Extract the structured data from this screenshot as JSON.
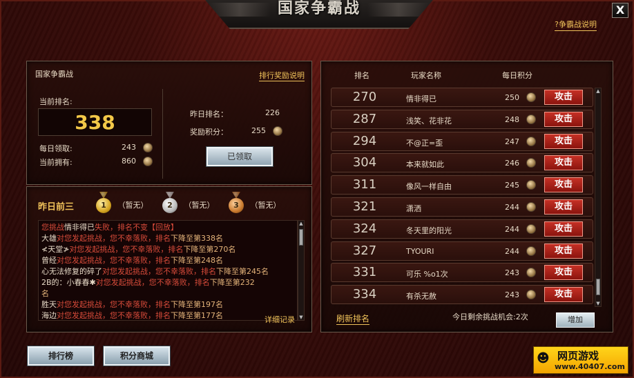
{
  "window": {
    "title": "国家争霸战",
    "help_link": "?争霸战说明",
    "close_label": "X"
  },
  "my_rank": {
    "panel_title": "国家争霸战",
    "reward_link": "排行奖励说明",
    "current_rank_label": "当前排名:",
    "current_rank": "338",
    "daily_label": "每日领取:",
    "daily_value": "243",
    "owned_label": "当前拥有:",
    "owned_value": "860",
    "yesterday_rank_label": "昨日排名：",
    "yesterday_rank": "226",
    "reward_points_label": "奖励积分：",
    "reward_points": "255",
    "claimed_button": "已领取"
  },
  "top3": {
    "title": "昨日前三",
    "entries": [
      {
        "medal": "1",
        "text": "（暂无）"
      },
      {
        "medal": "2",
        "text": "（暂无）"
      },
      {
        "medal": "3",
        "text": "（暂无）"
      }
    ],
    "detail_link": "详细记录"
  },
  "log": [
    [
      {
        "t": "您挑战",
        "c": "r"
      },
      {
        "t": "情非得已",
        "c": "n"
      },
      {
        "t": "失败，排名不变【回放】",
        "c": "r"
      }
    ],
    [
      {
        "t": "大雄",
        "c": "n"
      },
      {
        "t": "对您发起挑战，您不幸落败，排名",
        "c": "r"
      },
      {
        "t": "下降至第338名",
        "c": "b"
      }
    ],
    [
      {
        "t": "≮天堂≯",
        "c": "n"
      },
      {
        "t": "对您发起挑战，您不幸落败，排名",
        "c": "r"
      },
      {
        "t": "下降至第270名",
        "c": "b"
      }
    ],
    [
      {
        "t": "曾经",
        "c": "n"
      },
      {
        "t": "对您发起挑战，您不幸落败，排名",
        "c": "r"
      },
      {
        "t": "下降至第248名",
        "c": "b"
      }
    ],
    [
      {
        "t": "心无法修复的碎了",
        "c": "n"
      },
      {
        "t": "对您发起挑战，您不幸落败，排名",
        "c": "r"
      },
      {
        "t": "下降至第245名",
        "c": "b"
      }
    ],
    [
      {
        "t": "       2B的：小春春✱",
        "c": "n"
      },
      {
        "t": "对您发起挑战，您不幸落败，排名",
        "c": "r"
      },
      {
        "t": "下降至第232",
        "c": "b"
      }
    ],
    [
      {
        "t": "名",
        "c": "b"
      }
    ],
    [
      {
        "t": "胜天",
        "c": "n"
      },
      {
        "t": "对您发起挑战，您不幸落败，排名",
        "c": "r"
      },
      {
        "t": "下降至第197名",
        "c": "b"
      }
    ],
    [
      {
        "t": "海边",
        "c": "n"
      },
      {
        "t": "对您发起挑战，您不幸落败，排名",
        "c": "r"
      },
      {
        "t": "下降至第177名",
        "c": "b"
      }
    ]
  ],
  "leaderboard": {
    "headers": {
      "rank": "排名",
      "name": "玩家名称",
      "score": "每日积分"
    },
    "attack_label": "攻击",
    "rows": [
      {
        "rank": "270",
        "name": "情非得已",
        "score": "250"
      },
      {
        "rank": "287",
        "name": "浅笑、花非花",
        "score": "248"
      },
      {
        "rank": "294",
        "name": "不@正=歪",
        "score": "247"
      },
      {
        "rank": "304",
        "name": "本来就如此",
        "score": "246"
      },
      {
        "rank": "311",
        "name": "像风一样自由",
        "score": "245"
      },
      {
        "rank": "321",
        "name": "潇洒",
        "score": "244"
      },
      {
        "rank": "324",
        "name": "冬天里的阳光",
        "score": "244"
      },
      {
        "rank": "327",
        "name": "TYOURI",
        "score": "244"
      },
      {
        "rank": "331",
        "name": "可乐 %o1次",
        "score": "243"
      },
      {
        "rank": "334",
        "name": "有杀无赦",
        "score": "243"
      }
    ],
    "refresh_link": "刷新排名",
    "chances_text": "今日剩余挑战机会:2次",
    "add_button": "增加"
  },
  "bottom": {
    "ranking_button": "排行榜",
    "shop_button": "积分商城"
  },
  "logo": {
    "brand": "网页游戏",
    "site": "www.40407.com"
  },
  "colors": {
    "accent": "#f0c25a",
    "attack": "#c53025",
    "panel_bg": "#2a0f0b"
  }
}
